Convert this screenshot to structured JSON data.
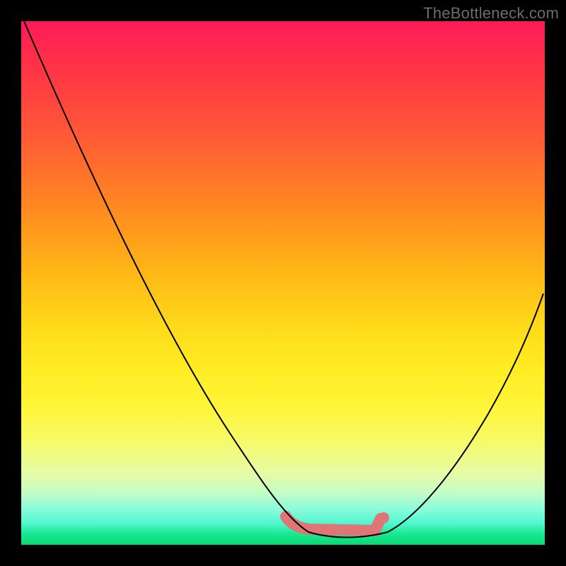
{
  "watermark": "TheBottleneck.com",
  "chart_data": {
    "type": "line",
    "title": "",
    "xlabel": "",
    "ylabel": "",
    "xlim": [
      0,
      1
    ],
    "ylim": [
      0,
      1
    ],
    "series": [
      {
        "name": "bottleneck-curve-left",
        "x": [
          0.005,
          0.08,
          0.16,
          0.24,
          0.32,
          0.4,
          0.46,
          0.505,
          0.55
        ],
        "y": [
          1.0,
          0.82,
          0.64,
          0.46,
          0.3,
          0.16,
          0.07,
          0.025,
          0.012
        ]
      },
      {
        "name": "bottleneck-curve-right",
        "x": [
          0.7,
          0.74,
          0.78,
          0.83,
          0.88,
          0.93,
          0.985
        ],
        "y": [
          0.018,
          0.04,
          0.08,
          0.14,
          0.23,
          0.34,
          0.48
        ]
      },
      {
        "name": "bottleneck-floor",
        "x": [
          0.55,
          0.59,
          0.63,
          0.66,
          0.7
        ],
        "y": [
          0.012,
          0.01,
          0.01,
          0.012,
          0.018
        ]
      },
      {
        "name": "optimal-marker",
        "x": [
          0.505,
          0.68
        ],
        "y": [
          0.047,
          0.047
        ]
      }
    ],
    "background_gradient": {
      "top": "#ff1a58",
      "mid": "#ffe53a",
      "bottom": "#0cd971"
    }
  }
}
